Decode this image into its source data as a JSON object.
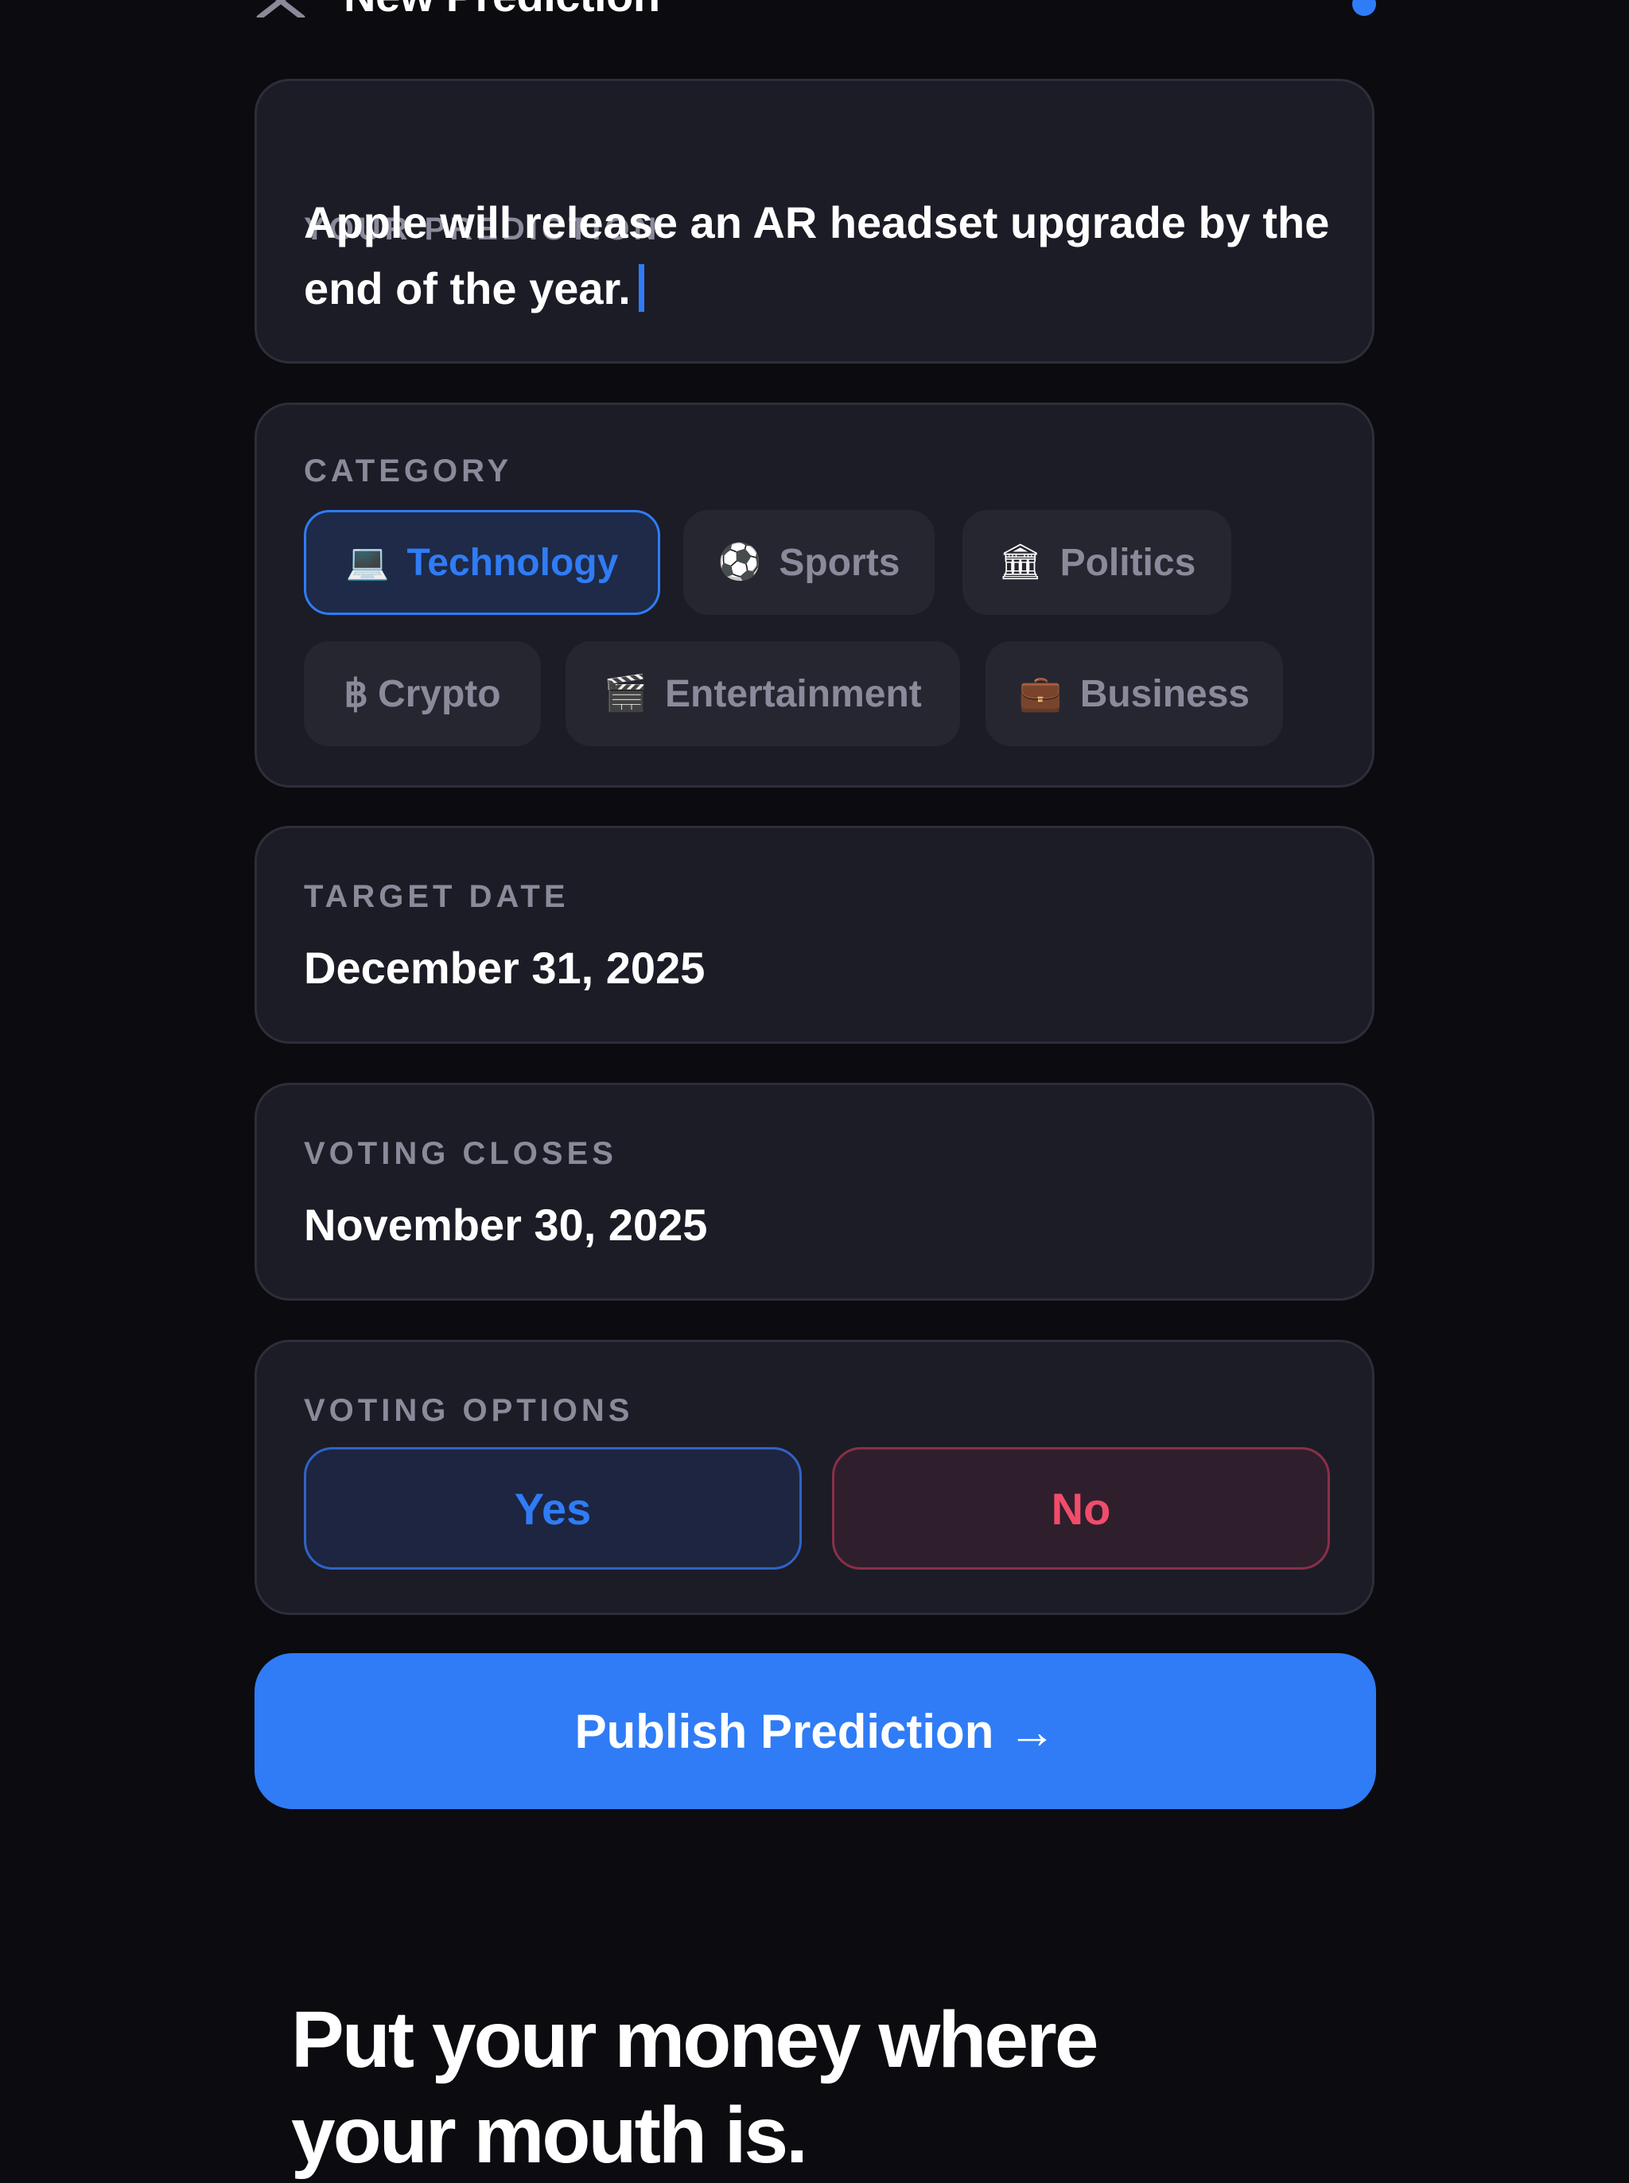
{
  "header": {
    "title": "New Prediction",
    "close_icon": "close-icon",
    "status_color": "#2f7cf6"
  },
  "prediction": {
    "label": "YOUR PREDICTION",
    "text": "Apple will release an AR headset upgrade by the end of the year."
  },
  "category": {
    "label": "CATEGORY",
    "selected": "Technology",
    "chips": [
      {
        "icon": "laptop-icon",
        "emoji": "💻",
        "label": "Technology"
      },
      {
        "icon": "soccer-ball-icon",
        "emoji": "⚽",
        "label": "Sports"
      },
      {
        "icon": "classical-building-icon",
        "emoji": "🏛",
        "label": "Politics"
      },
      {
        "icon": "bitcoin-icon",
        "emoji": "฿",
        "label": "Crypto"
      },
      {
        "icon": "clapper-board-icon",
        "emoji": "🎬",
        "label": "Entertainment"
      },
      {
        "icon": "briefcase-icon",
        "emoji": "💼",
        "label": "Business"
      }
    ]
  },
  "target_date": {
    "label": "TARGET DATE",
    "value": "December 31, 2025"
  },
  "voting_closes": {
    "label": "VOTING CLOSES",
    "value": "November 30, 2025"
  },
  "voting_options": {
    "label": "VOTING OPTIONS",
    "yes": "Yes",
    "no": "No"
  },
  "publish": {
    "label": "Publish Prediction",
    "arrow": "→"
  },
  "tagline": {
    "line1": "Put your money where",
    "line2": "your mouth is."
  },
  "colors": {
    "accent": "#2f7cf6",
    "background": "#0b0b10",
    "card": "#1c1c26",
    "no_red": "#f04c6c"
  }
}
